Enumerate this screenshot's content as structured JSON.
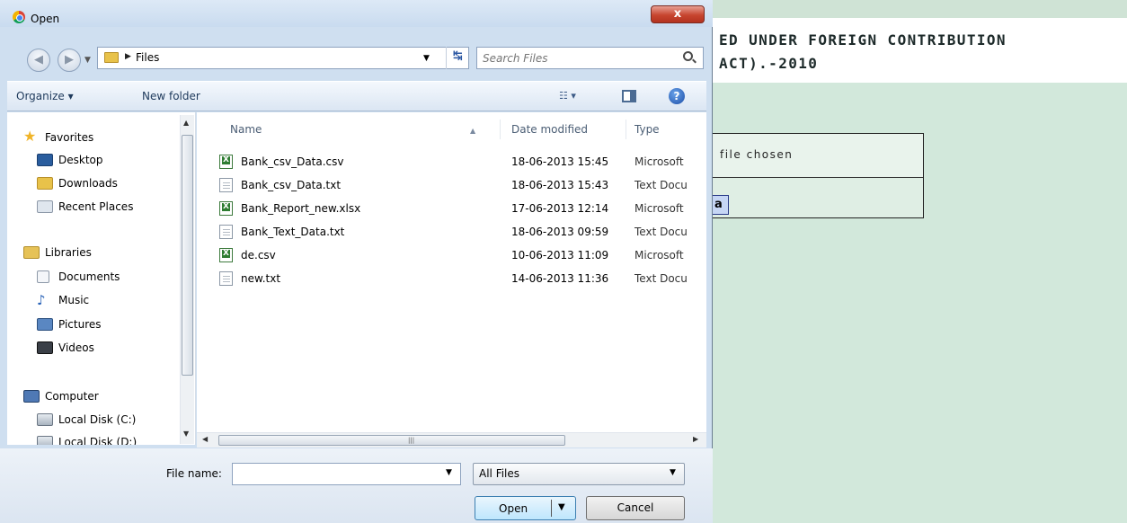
{
  "window": {
    "title": "Open",
    "close_label": "x"
  },
  "background_page": {
    "heading": "ED UNDER FOREIGN CONTRIBUTION\nACT).-2010",
    "no_file_text": "file chosen",
    "submit_fragment": "a"
  },
  "address": {
    "crumb": "Files"
  },
  "search": {
    "placeholder": "Search Files"
  },
  "toolbar": {
    "organize_label": "Organize ▾",
    "new_folder_label": "New folder",
    "views_label": "☷ ▾",
    "help_label": "?"
  },
  "nav_pane": {
    "items": [
      {
        "label": "Favorites",
        "icon": "star-icon"
      },
      {
        "label": "Desktop",
        "icon": "desktop-icon"
      },
      {
        "label": "Downloads",
        "icon": "downloads-icon"
      },
      {
        "label": "Recent Places",
        "icon": "recent-places-icon"
      },
      {
        "label": "Libraries",
        "icon": "libraries-icon"
      },
      {
        "label": "Documents",
        "icon": "documents-icon"
      },
      {
        "label": "Music",
        "icon": "music-icon"
      },
      {
        "label": "Pictures",
        "icon": "pictures-icon"
      },
      {
        "label": "Videos",
        "icon": "videos-icon"
      },
      {
        "label": "Computer",
        "icon": "computer-icon"
      },
      {
        "label": "Local Disk (C:)",
        "icon": "drive-icon"
      },
      {
        "label": "Local Disk (D:)",
        "icon": "drive-icon"
      }
    ]
  },
  "file_list": {
    "columns": {
      "name": "Name",
      "date": "Date modified",
      "type": "Type"
    },
    "files": [
      {
        "name": "Bank_csv_Data.csv",
        "date": "18-06-2013 15:45",
        "type": "Microsoft",
        "icon": "excel-file-icon"
      },
      {
        "name": "Bank_csv_Data.txt",
        "date": "18-06-2013 15:43",
        "type": "Text Docu",
        "icon": "text-file-icon"
      },
      {
        "name": "Bank_Report_new.xlsx",
        "date": "17-06-2013 12:14",
        "type": "Microsoft",
        "icon": "excel-file-icon"
      },
      {
        "name": "Bank_Text_Data.txt",
        "date": "18-06-2013 09:59",
        "type": "Text Docu",
        "icon": "text-file-icon"
      },
      {
        "name": "de.csv",
        "date": "10-06-2013 11:09",
        "type": "Microsoft",
        "icon": "excel-file-icon"
      },
      {
        "name": "new.txt",
        "date": "14-06-2013 11:36",
        "type": "Text Docu",
        "icon": "text-file-icon"
      }
    ]
  },
  "bottom": {
    "file_name_label": "File name:",
    "file_name_value": "",
    "file_type_value": "All Files",
    "open_label": "Open",
    "cancel_label": "Cancel"
  },
  "colors": {
    "dialog_frame": "#cfdff0",
    "page_bg": "#d2e8db",
    "close_red": "#c7452f",
    "open_btn": "#bee6fd"
  }
}
